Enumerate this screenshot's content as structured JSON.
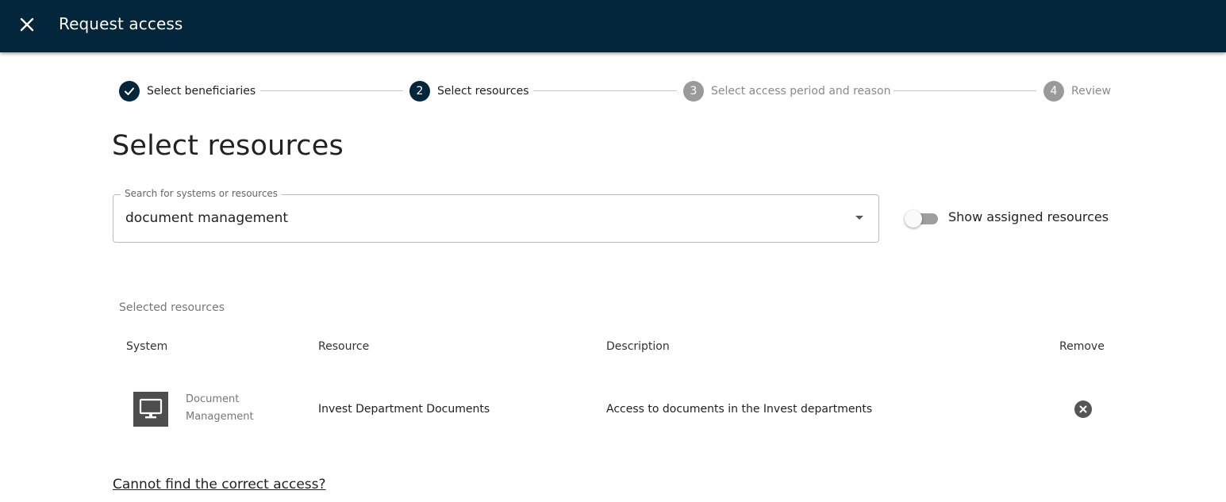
{
  "header": {
    "title": "Request access",
    "close_icon": "close-icon",
    "background": "#03263a"
  },
  "stepper": {
    "steps": [
      {
        "number": "1",
        "label": "Select beneficiaries",
        "state": "done"
      },
      {
        "number": "2",
        "label": "Select resources",
        "state": "active"
      },
      {
        "number": "3",
        "label": "Select access period and reason",
        "state": "pending"
      },
      {
        "number": "4",
        "label": "Review",
        "state": "pending"
      }
    ]
  },
  "page": {
    "title": "Select resources"
  },
  "search": {
    "label": "Search for systems or resources",
    "value": "document management"
  },
  "toggle": {
    "label": "Show assigned resources",
    "checked": false
  },
  "selected": {
    "caption": "Selected resources",
    "columns": {
      "system": "System",
      "resource": "Resource",
      "description": "Description",
      "remove": "Remove"
    },
    "rows": [
      {
        "system_icon": "monitor-icon",
        "system": "Document Management",
        "resource": "Invest Department Documents",
        "description": "Access to documents in the Invest departments",
        "remove_icon": "remove-circle-icon"
      }
    ]
  },
  "help_link": "Cannot find the correct access?"
}
